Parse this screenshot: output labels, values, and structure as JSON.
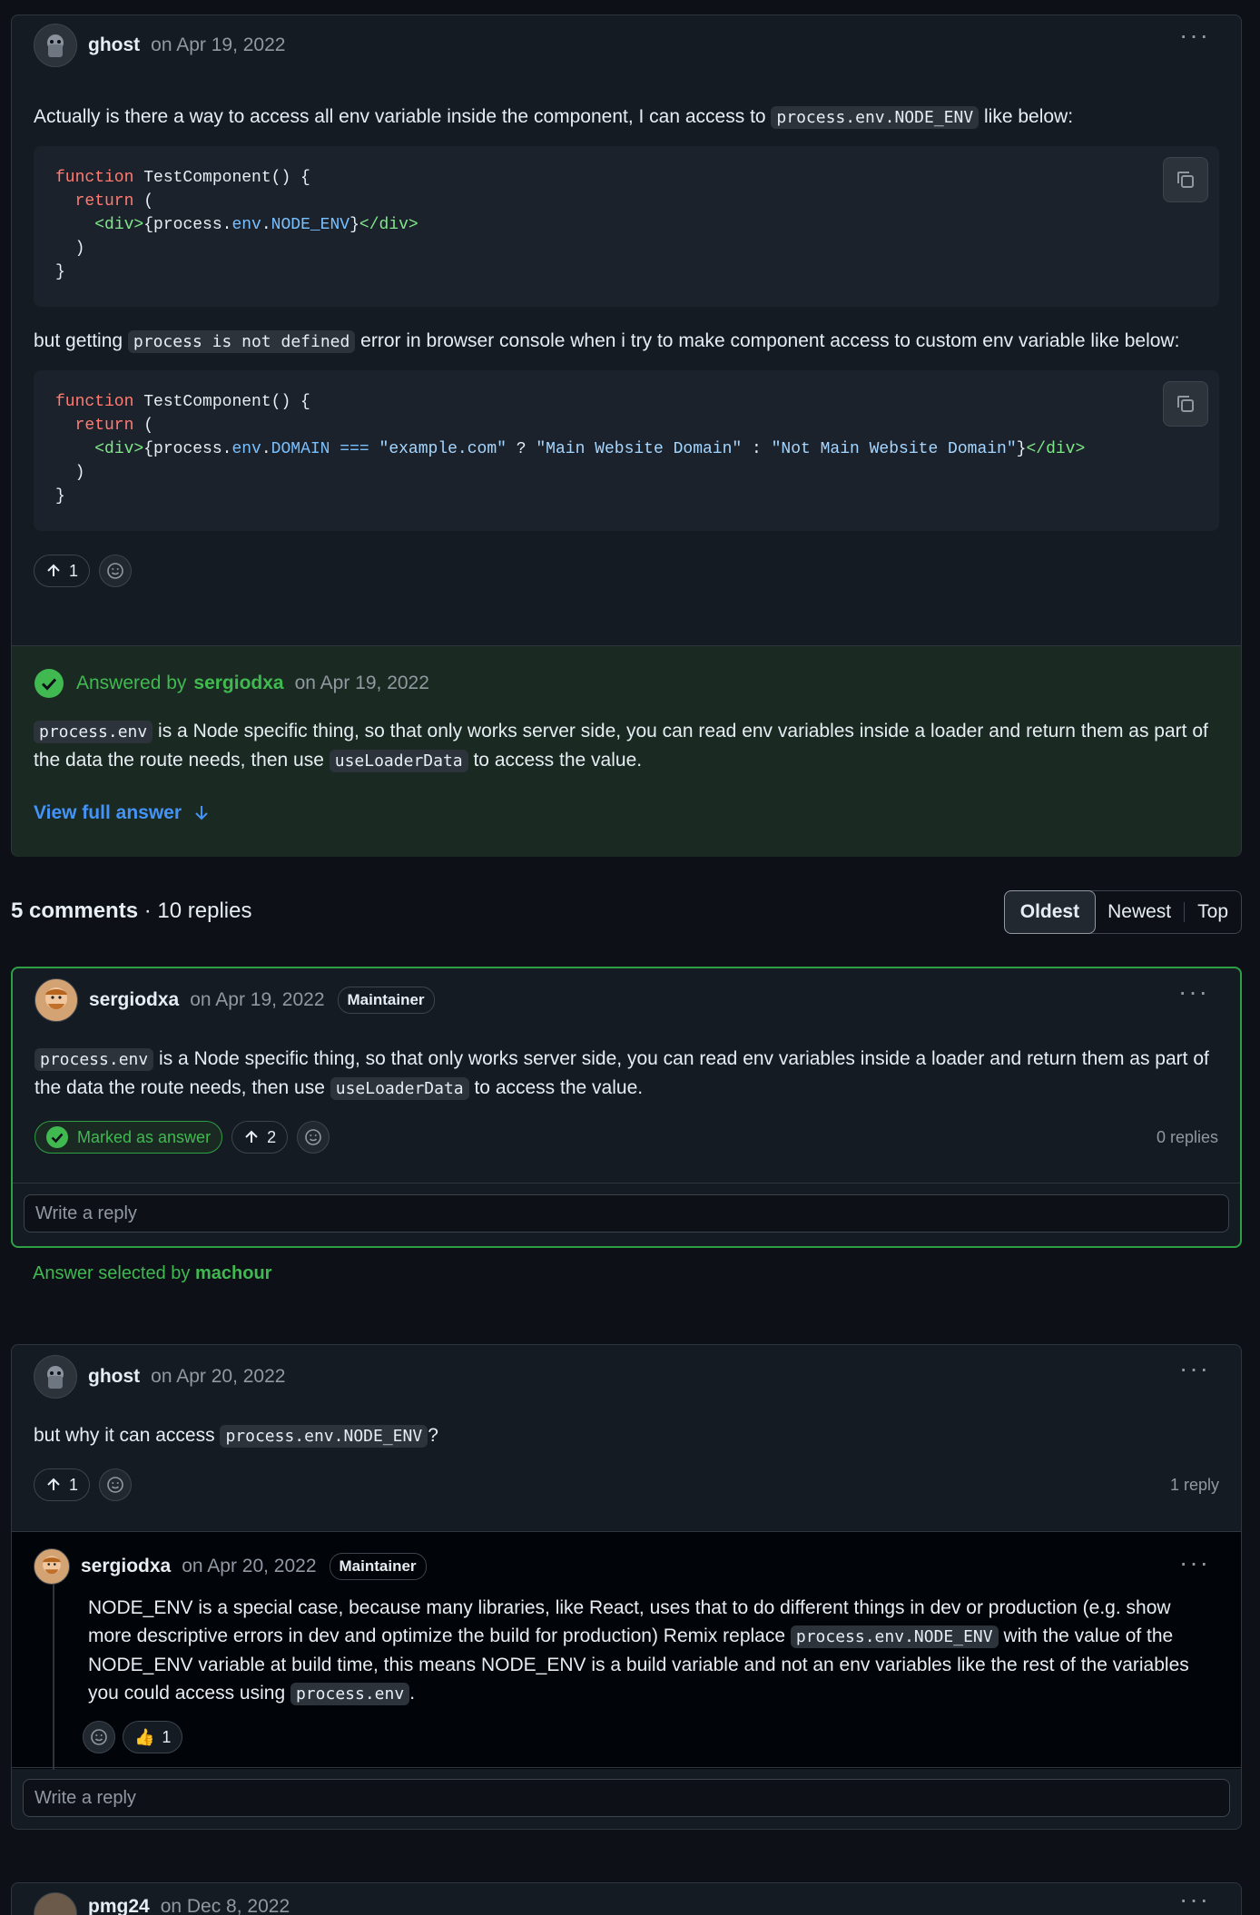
{
  "question": {
    "author": "ghost",
    "date": "on Apr 19, 2022",
    "text1_pre": "Actually is there a way to access all env variable inside the component, I can access to ",
    "text1_code": "process.env.NODE_ENV",
    "text1_post": " like below:",
    "code1": {
      "l1_kw": "function",
      "l1_rest": " TestComponent() {",
      "l2_kw": "  return",
      "l2_rest": " (",
      "l3_indent": "    ",
      "l3_open": "<div>",
      "l3_a": "{process.",
      "l3_b": "env",
      "l3_c": ".",
      "l3_d": "NODE_ENV",
      "l3_e": "}",
      "l3_close": "</div>",
      "l4": "  )",
      "l5": "}"
    },
    "text2_pre": "but getting ",
    "text2_code": "process is not defined",
    "text2_post": " error in browser console when i try to make component access to custom env variable like below:",
    "code2": {
      "l1_kw": "function",
      "l1_rest": " TestComponent() {",
      "l2_kw": "  return",
      "l2_rest": " (",
      "l3_indent": "    ",
      "l3_open": "<div>",
      "l3_a": "{process.",
      "l3_b": "env",
      "l3_c": ".",
      "l3_d": "DOMAIN",
      "l3_e": " ",
      "l3_op": "===",
      "l3_f": " ",
      "l3_s1": "\"example.com\"",
      "l3_g": " ? ",
      "l3_s2": "\"Main Website Domain\"",
      "l3_h": " : ",
      "l3_s3": "\"Not Main Website Domain\"",
      "l3_i": "}",
      "l3_close": "</div>",
      "l4": "  )",
      "l5": "}"
    },
    "upvotes": "1"
  },
  "answer_box": {
    "answered_by": "Answered by",
    "answerer": "sergiodxa",
    "date": "on Apr 19, 2022",
    "code1": "process.env",
    "text_a": " is a Node specific thing, so that only works server side, you can read env variables inside a loader and return them as part of the data the route needs, then use ",
    "code2": "useLoaderData",
    "text_b": " to access the value.",
    "view_full": "View full answer"
  },
  "comments_header": {
    "comments": "5 comments",
    "sep": " · ",
    "replies": "10 replies",
    "sort_options": [
      "Oldest",
      "Newest",
      "Top"
    ]
  },
  "comment1": {
    "author": "sergiodxa",
    "date": "on Apr 19, 2022",
    "badge": "Maintainer",
    "code1": "process.env",
    "text_a": " is a Node specific thing, so that only works server side, you can read env variables inside a loader and return them as part of the data the route needs, then use ",
    "code2": "useLoaderData",
    "text_b": " to access the value.",
    "marked": "Marked as answer",
    "upvotes": "2",
    "reply_count": "0 replies",
    "reply_placeholder": "Write a reply",
    "selected_by_pre": "Answer selected by ",
    "selected_by": "machour"
  },
  "comment2": {
    "author": "ghost",
    "date": "on Apr 20, 2022",
    "text_pre": "but why it can access ",
    "code": "process.env.NODE_ENV",
    "text_post": "?",
    "upvotes": "1",
    "reply_count": "1 reply",
    "reply": {
      "author": "sergiodxa",
      "date": "on Apr 20, 2022",
      "badge": "Maintainer",
      "text_a": "NODE_ENV is a special case, because many libraries, like React, uses that to do different things in dev or production (e.g. show more descriptive errors in dev and optimize the build for production) Remix replace ",
      "code1": "process.env.NODE_ENV",
      "text_b": " with the value of the NODE_ENV variable at build time, this means NODE_ENV is a build variable and not an env variables like the rest of the variables you could access using ",
      "code2": "process.env",
      "text_c": ".",
      "thumbs_emoji": "👍",
      "thumbs_count": "1"
    },
    "reply_placeholder": "Write a reply"
  },
  "comment3": {
    "author": "pmg24",
    "date": "on Dec 8, 2022"
  },
  "colors": {
    "background": "#0d1117",
    "card": "#151b23",
    "accent_green": "#3fb950",
    "link_blue": "#4493f8"
  }
}
